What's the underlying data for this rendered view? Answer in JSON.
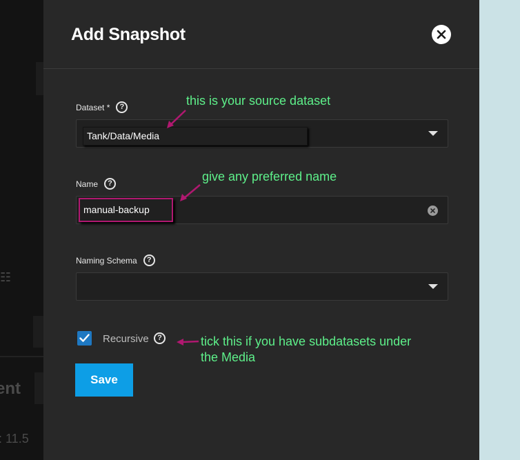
{
  "background": {
    "partial_text_1": "ent",
    "partial_text_2": ": 11.5"
  },
  "dialog": {
    "title": "Add Snapshot",
    "close_icon": "close-icon",
    "dataset": {
      "label": "Dataset *",
      "value": "Tank/Data/Media"
    },
    "name": {
      "label": "Name",
      "value": "manual-backup"
    },
    "naming_schema": {
      "label": "Naming Schema",
      "value": ""
    },
    "recursive": {
      "label": "Recursive",
      "checked": true
    },
    "save_label": "Save"
  },
  "annotations": {
    "dataset_note": "this is your source dataset",
    "name_note": "give any preferred name",
    "recursive_note_line1": "tick this if you have subdatasets under",
    "recursive_note_line2": "the Media"
  },
  "colors": {
    "panel_bg": "#282828",
    "accent_blue": "#0d9ee6",
    "annotation_green": "#5ef08a",
    "annotation_arrow": "#b01870"
  }
}
